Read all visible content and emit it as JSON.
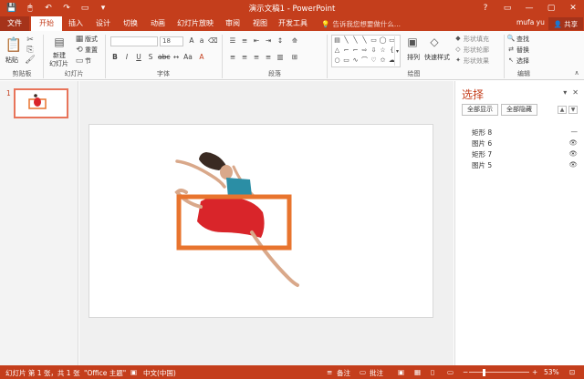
{
  "titlebar": {
    "title": "演示文稿1 - PowerPoint",
    "qat": [
      "💾",
      "🖱",
      "↶",
      "↷",
      "▭",
      "▾"
    ],
    "win_controls": [
      "?",
      "▭",
      "—",
      "▢",
      "✕"
    ]
  },
  "tabs": [
    {
      "label": "文件"
    },
    {
      "label": "开始"
    },
    {
      "label": "插入"
    },
    {
      "label": "设计"
    },
    {
      "label": "切换"
    },
    {
      "label": "动画"
    },
    {
      "label": "幻灯片放映"
    },
    {
      "label": "审阅"
    },
    {
      "label": "视图"
    },
    {
      "label": "开发工具"
    }
  ],
  "tell_me": "告诉我您想要做什么...",
  "user": {
    "name": "mufa yu",
    "share": "共享"
  },
  "ribbon": {
    "clipboard": {
      "label": "剪贴板",
      "paste": "粘贴"
    },
    "slides": {
      "label": "幻灯片",
      "new_slide_1": "新建",
      "new_slide_2": "幻灯片",
      "layout": "版式",
      "reset": "重置",
      "section": "节"
    },
    "font": {
      "label": "字体",
      "font_size": "18"
    },
    "paragraph": {
      "label": "段落"
    },
    "drawing": {
      "label": "绘图",
      "arrange": "排列",
      "quick_styles": "快速样式",
      "fill": "形状填充",
      "outline": "形状轮廓",
      "effects": "形状效果"
    },
    "editing": {
      "label": "编辑",
      "find": "查找",
      "replace": "替换",
      "select": "选择"
    }
  },
  "thumbnails": [
    {
      "number": "1"
    }
  ],
  "selection_pane": {
    "title": "选择",
    "show_all": "全部显示",
    "hide_all": "全部隐藏",
    "items": [
      {
        "name": "矩形 8",
        "visibility": "—"
      },
      {
        "name": "图片 6",
        "visibility": "👁"
      },
      {
        "name": "矩形 7",
        "visibility": "👁"
      },
      {
        "name": "图片 5",
        "visibility": "👁"
      }
    ]
  },
  "statusbar": {
    "slide_info": "幻灯片 第 1 张，共 1 张",
    "theme": "\"Office 主题\"",
    "language": "中文(中国)",
    "notes": "备注",
    "comments": "批注",
    "zoom": "53%",
    "zoom_level": 0.53
  },
  "colors": {
    "accent": "#c43e1c",
    "frame": "#e8742e",
    "dress": "#d9252a",
    "top": "#2b8ea5"
  }
}
